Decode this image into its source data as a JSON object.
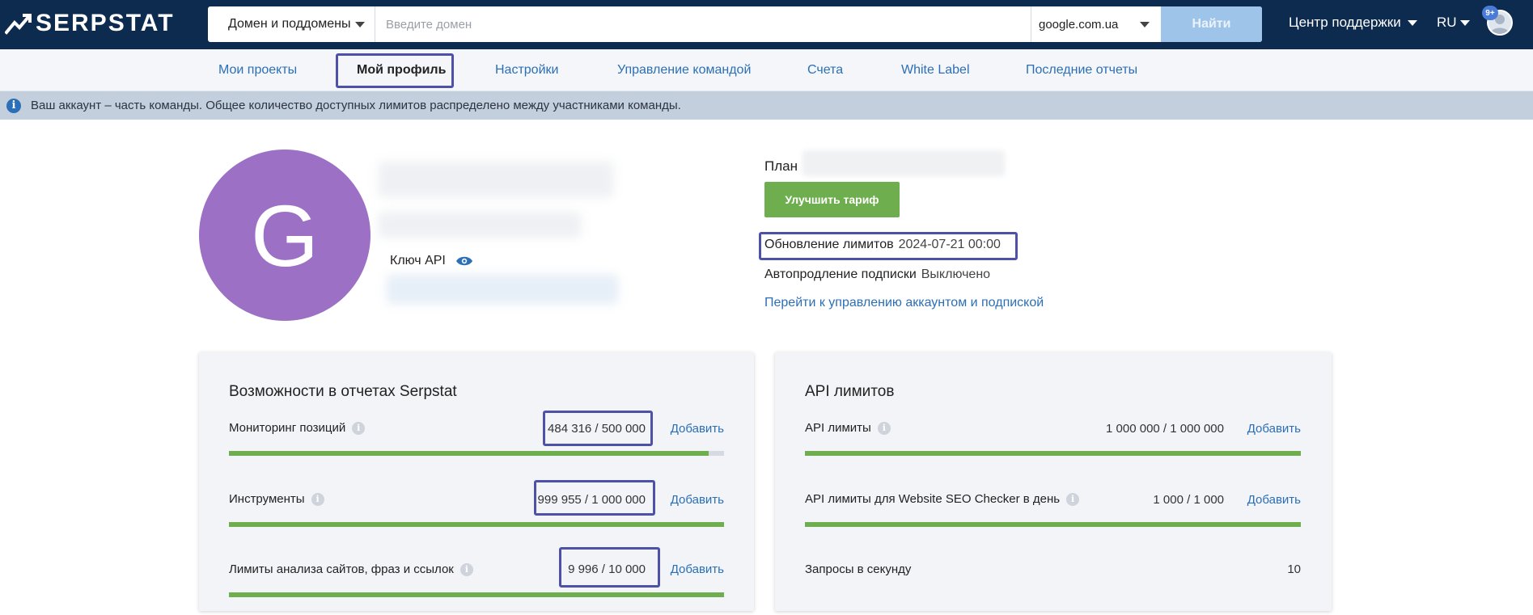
{
  "header": {
    "logo_text": "SERPSTAT",
    "search_mode": "Домен и поддомены",
    "search_placeholder": "Введите домен",
    "search_value": "",
    "search_engine": "google.com.ua",
    "search_button": "Найти",
    "support_label": "Центр поддержки",
    "language": "RU",
    "notifications_badge": "9+"
  },
  "subnav": {
    "items": [
      {
        "label": "Мои проекты"
      },
      {
        "label": "Мой профиль"
      },
      {
        "label": "Настройки"
      },
      {
        "label": "Управление командой"
      },
      {
        "label": "Счета"
      },
      {
        "label": "White Label"
      },
      {
        "label": "Последние отчеты"
      }
    ],
    "active_index": 1
  },
  "banner": {
    "icon": "info-icon",
    "text": "Ваш аккаунт – часть команды. Общее количество доступных лимитов распределено между участниками команды."
  },
  "profile": {
    "avatar_letter": "G",
    "avatar_color": "#9b70c5",
    "api_key_label": "Ключ API"
  },
  "plan": {
    "plan_label": "План",
    "upgrade_button": "Улучшить тариф",
    "limits_update_label": "Обновление лимитов",
    "limits_update_value": "2024-07-21 00:00",
    "autorenew_label": "Автопродление подписки",
    "autorenew_value": "Выключено",
    "account_link": "Перейти к управлению аккаунтом и подпиской"
  },
  "reports_card": {
    "title": "Возможности в отчетах Serpstat",
    "rows": [
      {
        "label": "Мониторинг позиций",
        "value": "484 316 / 500 000",
        "add": "Добавить",
        "used_fraction": 0.9686
      },
      {
        "label": "Инструменты",
        "value": "999 955 / 1 000 000",
        "add": "Добавить",
        "used_fraction": 0.99996
      },
      {
        "label": "Лимиты анализа сайтов, фраз и ссылок",
        "value": "9 996 / 10 000",
        "add": "Добавить",
        "used_fraction": 0.9996
      }
    ]
  },
  "api_card": {
    "title": "API лимитов",
    "rows": [
      {
        "label": "API лимиты",
        "value": "1 000 000 / 1 000 000",
        "add": "Добавить",
        "used_fraction": 1.0
      },
      {
        "label": "API лимиты для Website SEO Checker в день",
        "value": "1 000 / 1 000",
        "add": "Добавить",
        "used_fraction": 1.0
      },
      {
        "label": "Запросы в секунду",
        "value": "10"
      }
    ]
  },
  "colors": {
    "topbar": "#0d2a4f",
    "accent_green": "#6fae4f",
    "link_blue": "#2b6fb6",
    "highlight_frame": "#4d51a8"
  }
}
